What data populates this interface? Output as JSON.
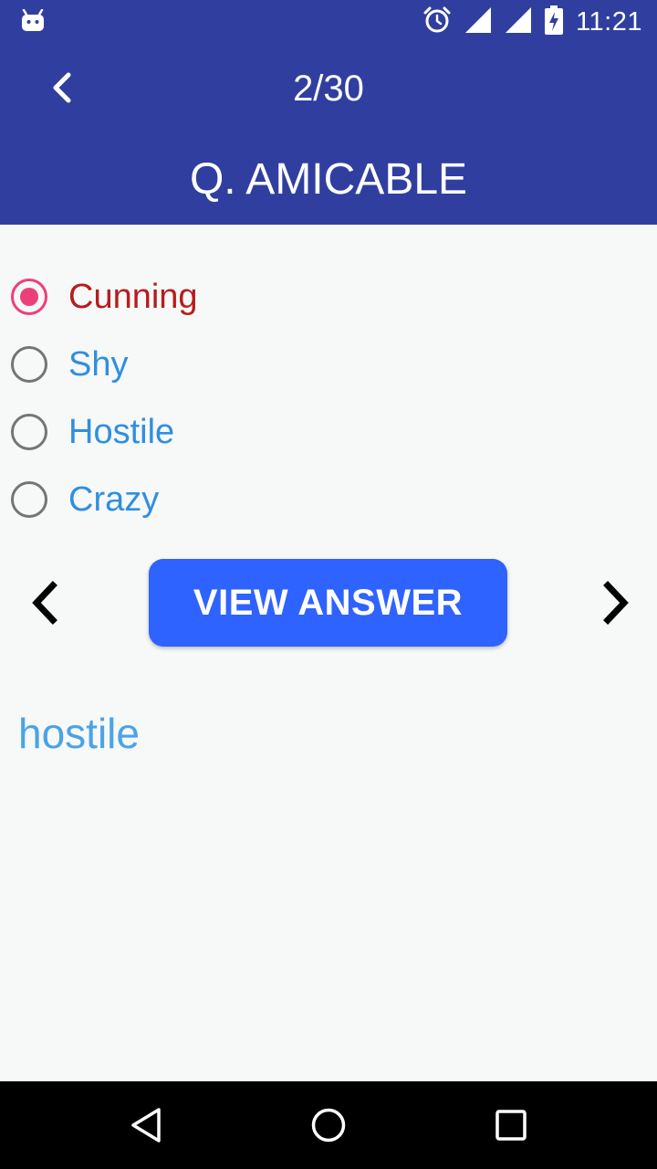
{
  "status_bar": {
    "time": "11:21",
    "icons": [
      "android-debug-icon",
      "alarm-icon",
      "signal-icon",
      "signal-icon",
      "battery-charging-icon"
    ]
  },
  "header": {
    "counter": "2/30",
    "question": "Q. AMICABLE",
    "background": "#303f9f"
  },
  "options": [
    {
      "label": "Cunning",
      "selected": true
    },
    {
      "label": "Shy",
      "selected": false
    },
    {
      "label": "Hostile",
      "selected": false
    },
    {
      "label": "Crazy",
      "selected": false
    }
  ],
  "controls": {
    "view_answer_label": "VIEW ANSWER",
    "prev_icon": "chevron-left-icon",
    "next_icon": "chevron-right-icon",
    "button_color": "#2e63ff"
  },
  "answer": {
    "text": "hostile"
  },
  "nav_bar": {
    "icons": [
      "back-triangle-icon",
      "home-circle-icon",
      "recents-square-icon"
    ]
  },
  "colors": {
    "selected_radio": "#ec407a",
    "selected_label": "#b71c1c",
    "option_label": "#2f8fe0",
    "answer_text": "#4aa3e8"
  }
}
